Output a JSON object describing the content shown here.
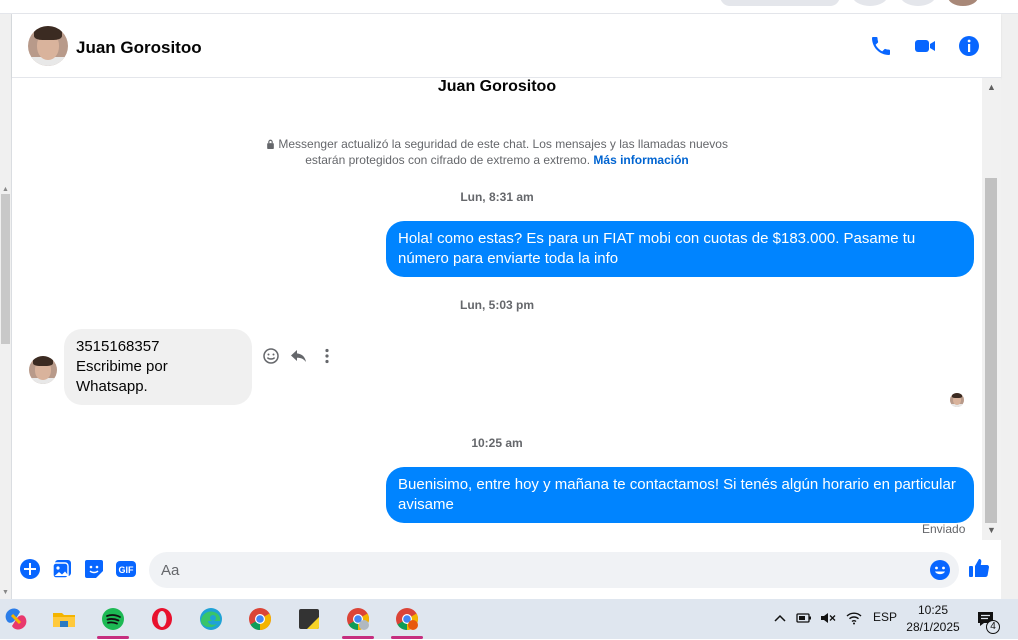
{
  "header": {
    "contact_name": "Juan Gorositoo"
  },
  "conversation": {
    "title": "Juan Gorositoo",
    "security_notice": "Messenger actualizó la seguridad de este chat. Los mensajes y las llamadas nuevos estarán protegidos con cifrado de extremo a extremo.",
    "security_link": "Más información",
    "messages": [
      {
        "timestamp": "Lun, 8:31 am",
        "direction": "out",
        "text": "Hola! como estas? Es para un FIAT mobi con cuotas de $183.000. Pasame tu número para enviarte toda la info"
      },
      {
        "timestamp": "Lun, 5:03 pm",
        "direction": "in",
        "lines": [
          "3515168357",
          "Escribime por Whatsapp."
        ]
      },
      {
        "timestamp": "10:25 am",
        "direction": "out",
        "text": "Buenisimo, entre hoy y mañana te contactamos! Si tenés algún horario en particular avisame"
      }
    ],
    "status": "Enviado"
  },
  "composer": {
    "placeholder": "Aa"
  },
  "taskbar": {
    "language": "ESP",
    "time": "10:25",
    "date": "28/1/2025",
    "notification_count": "4"
  },
  "colors": {
    "accent": "#0084ff",
    "icon_blue": "#0866ff",
    "incoming_bubble": "#f0f0f0"
  }
}
